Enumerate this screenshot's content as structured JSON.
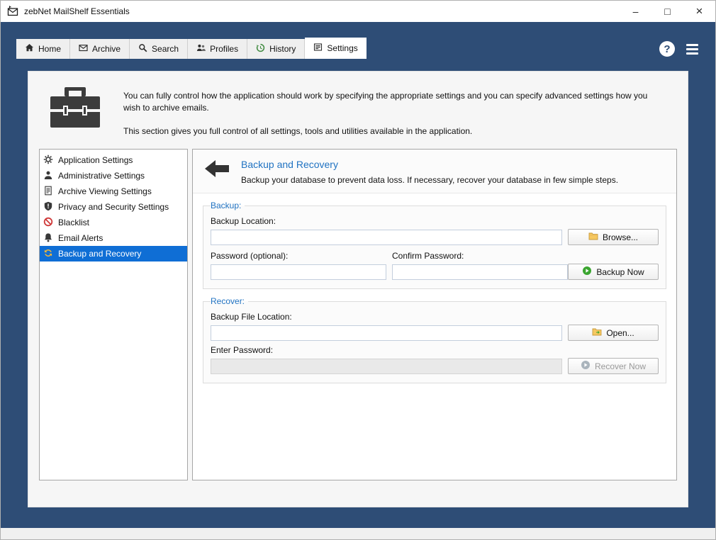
{
  "window": {
    "title": "zebNet MailShelf Essentials",
    "controls": {
      "minimize": "–",
      "maximize": "□",
      "close": "×"
    }
  },
  "tabs": [
    {
      "label": "Home"
    },
    {
      "label": "Archive"
    },
    {
      "label": "Search"
    },
    {
      "label": "Profiles"
    },
    {
      "label": "History"
    },
    {
      "label": "Settings"
    }
  ],
  "header_actions": {
    "help_label": "?"
  },
  "intro": {
    "p1": "You can fully control how the application should work by specifying the appropriate settings and you can specify advanced settings how you wish to archive emails.",
    "p2": "This section gives you full control of all settings, tools and utilities available in the application."
  },
  "sidebar": {
    "items": [
      {
        "label": "Application Settings",
        "icon": "gear-icon"
      },
      {
        "label": "Administrative Settings",
        "icon": "admin-user-icon"
      },
      {
        "label": "Archive Viewing Settings",
        "icon": "document-icon"
      },
      {
        "label": "Privacy and Security Settings",
        "icon": "shield-icon"
      },
      {
        "label": "Blacklist",
        "icon": "prohibition-icon"
      },
      {
        "label": "Email Alerts",
        "icon": "bell-icon"
      },
      {
        "label": "Backup and Recovery",
        "icon": "backup-refresh-icon",
        "selected": true
      }
    ]
  },
  "panel": {
    "title": "Backup and Recovery",
    "subtitle": "Backup your database to prevent data loss. If necessary, recover your database in few simple steps.",
    "backup_group": {
      "legend": "Backup:",
      "backup_location_label": "Backup Location:",
      "backup_location_value": "",
      "browse_button": "Browse...",
      "password_label": "Password (optional):",
      "password_value": "",
      "confirm_password_label": "Confirm Password:",
      "confirm_password_value": "",
      "backup_now_button": "Backup Now"
    },
    "recover_group": {
      "legend": "Recover:",
      "file_location_label": "Backup File Location:",
      "file_location_value": "",
      "open_button": "Open...",
      "enter_password_label": "Enter Password:",
      "enter_password_value": "",
      "recover_now_button": "Recover Now"
    }
  },
  "colors": {
    "chrome_blue": "#2e4d76",
    "selection_blue": "#0f6ed5",
    "accent_blue": "#2173c2",
    "blacklist_red": "#cf3a3a",
    "folder_yellow": "#f6c860",
    "backup_green": "#3aa52f"
  }
}
